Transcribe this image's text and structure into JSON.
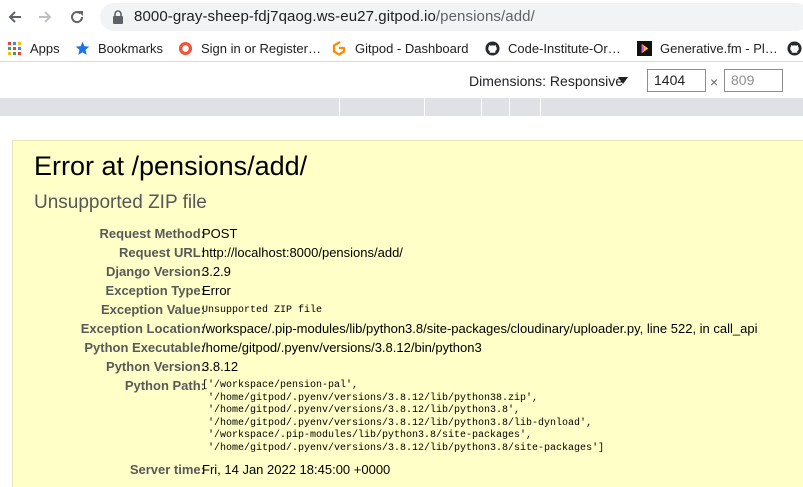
{
  "browser": {
    "url_host": "8000-gray-sheep-fdj7qaog.ws-eu27.gitpod.io",
    "url_path": "/pensions/add/"
  },
  "bookmarks": [
    {
      "label": "Apps",
      "icon": "apps-grid-icon"
    },
    {
      "label": "Bookmarks",
      "icon": "star-icon"
    },
    {
      "label": "Sign in or Register…",
      "icon": "eventbrite-icon"
    },
    {
      "label": "Gitpod - Dashboard",
      "icon": "gitpod-icon"
    },
    {
      "label": "Code-Institute-Or…",
      "icon": "github-icon"
    },
    {
      "label": "Generative.fm - Pl…",
      "icon": "generative-icon"
    }
  ],
  "devtools": {
    "dimensions_label": "Dimensions: Responsive",
    "width": "1404",
    "height": "809",
    "times": "×"
  },
  "error": {
    "title": "Error at /pensions/add/",
    "subtitle": "Unsupported ZIP file",
    "request_method_label": "Request Method:",
    "request_method": "POST",
    "request_url_label": "Request URL:",
    "request_url": "http://localhost:8000/pensions/add/",
    "django_version_label": "Django Version:",
    "django_version": "3.2.9",
    "exception_type_label": "Exception Type:",
    "exception_type": "Error",
    "exception_value_label": "Exception Value:",
    "exception_value": "Unsupported ZIP file",
    "exception_location_label": "Exception Location:",
    "exception_location": "/workspace/.pip-modules/lib/python3.8/site-packages/cloudinary/uploader.py, line 522, in call_api",
    "python_executable_label": "Python Executable:",
    "python_executable": "/home/gitpod/.pyenv/versions/3.8.12/bin/python3",
    "python_version_label": "Python Version:",
    "python_version": "3.8.12",
    "python_path_label": "Python Path:",
    "python_path": [
      "['/workspace/pension-pal',",
      " '/home/gitpod/.pyenv/versions/3.8.12/lib/python38.zip',",
      " '/home/gitpod/.pyenv/versions/3.8.12/lib/python3.8',",
      " '/home/gitpod/.pyenv/versions/3.8.12/lib/python3.8/lib-dynload',",
      " '/workspace/.pip-modules/lib/python3.8/site-packages',",
      " '/home/gitpod/.pyenv/versions/3.8.12/lib/python3.8/site-packages']"
    ],
    "server_time_label": "Server time:",
    "server_time": "Fri, 14 Jan 2022 18:45:00 +0000"
  }
}
